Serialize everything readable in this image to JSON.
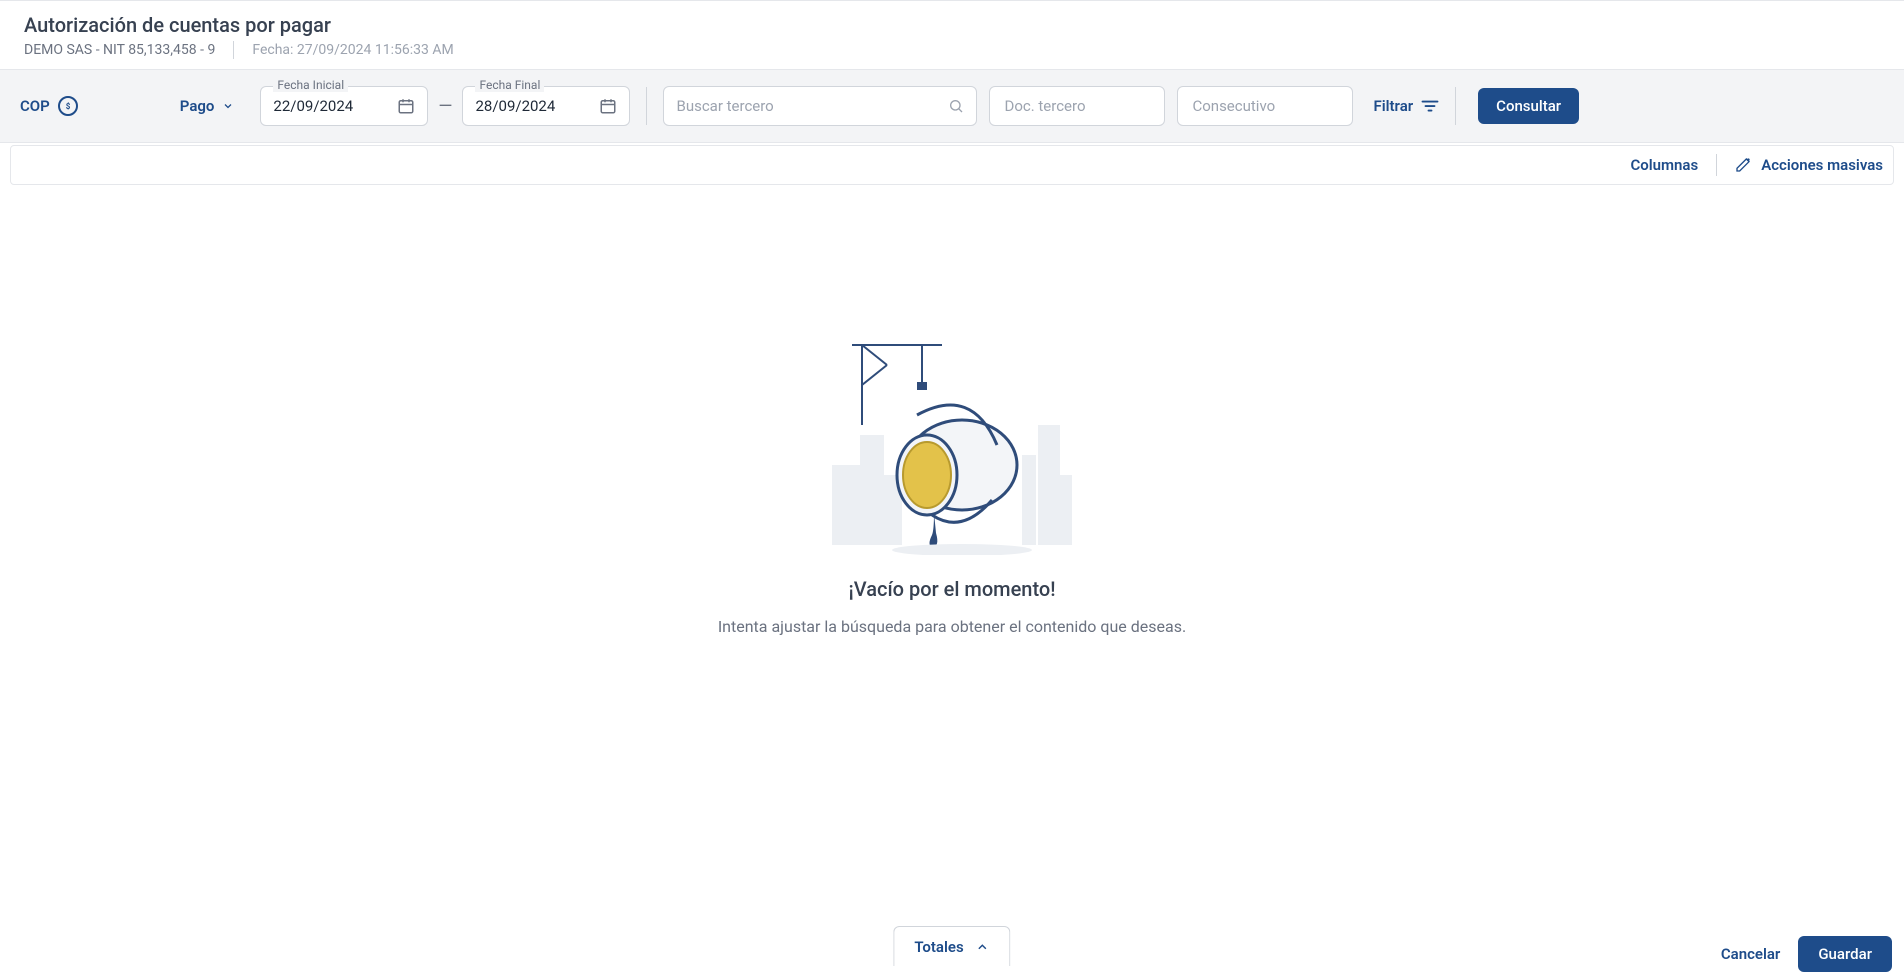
{
  "header": {
    "title": "Autorización de cuentas por pagar",
    "company": "DEMO SAS - NIT 85,133,458 - 9",
    "datetime": "Fecha: 27/09/2024 11:56:33 AM"
  },
  "filters": {
    "currency": "COP",
    "payment_type": "Pago",
    "date_initial_label": "Fecha Inicial",
    "date_initial": "22/09/2024",
    "date_final_label": "Fecha Final",
    "date_final": "28/09/2024",
    "search_placeholder": "Buscar tercero",
    "doc_placeholder": "Doc. tercero",
    "consecutivo_placeholder": "Consecutivo",
    "filtrar_label": "Filtrar",
    "consultar_label": "Consultar"
  },
  "actions": {
    "columnas": "Columnas",
    "masivas": "Acciones masivas"
  },
  "empty": {
    "title": "¡Vacío por el momento!",
    "subtitle": "Intenta ajustar la búsqueda para obtener el contenido que deseas."
  },
  "footer": {
    "totales": "Totales",
    "cancelar": "Cancelar",
    "guardar": "Guardar"
  }
}
